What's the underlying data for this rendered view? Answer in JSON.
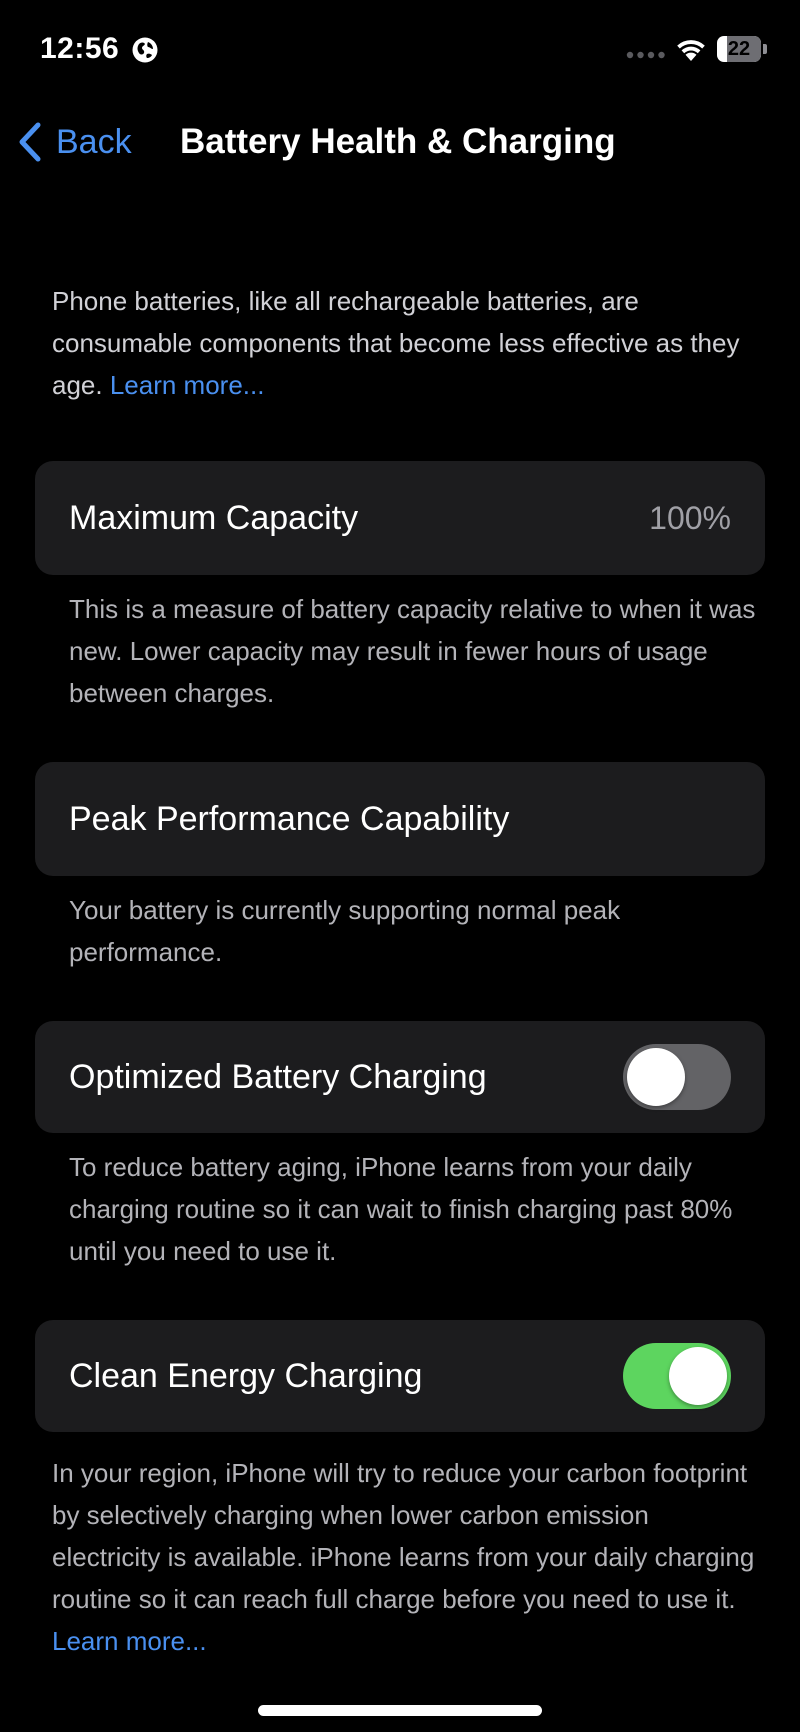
{
  "status_bar": {
    "time": "12:56",
    "battery_level": "22",
    "battery_fraction": 0.22
  },
  "nav": {
    "back_label": "Back",
    "title": "Battery Health & Charging"
  },
  "intro": {
    "text": "Phone batteries, like all rechargeable batteries, are consumable components that become less effective as they age. ",
    "link": "Learn more..."
  },
  "max_capacity": {
    "label": "Maximum Capacity",
    "value": "100%",
    "footnote": "This is a measure of battery capacity relative to when it was new. Lower capacity may result in fewer hours of usage between charges."
  },
  "peak_performance": {
    "label": "Peak Performance Capability",
    "footnote": "Your battery is currently supporting normal peak performance."
  },
  "optimized_charging": {
    "label": "Optimized Battery Charging",
    "enabled": false,
    "footnote": "To reduce battery aging, iPhone learns from your daily charging routine so it can wait to finish charging past 80% until you need to use it."
  },
  "clean_energy": {
    "label": "Clean Energy Charging",
    "enabled": true,
    "footnote": "In your region, iPhone will try to reduce your carbon footprint by selectively charging when lower carbon emission electricity is available. iPhone learns from your daily charging routine so it can reach full charge before you need to use it. ",
    "link": "Learn more..."
  },
  "colors": {
    "background": "#000000",
    "card": "#1c1c1e",
    "accent_blue": "#4a90f0",
    "toggle_on": "#5dd55f",
    "toggle_off": "#636366"
  },
  "icons": {
    "status": [
      "globe-icon",
      "signal-dots-icon",
      "wifi-icon",
      "battery-icon"
    ],
    "nav": [
      "chevron-left-icon"
    ]
  }
}
